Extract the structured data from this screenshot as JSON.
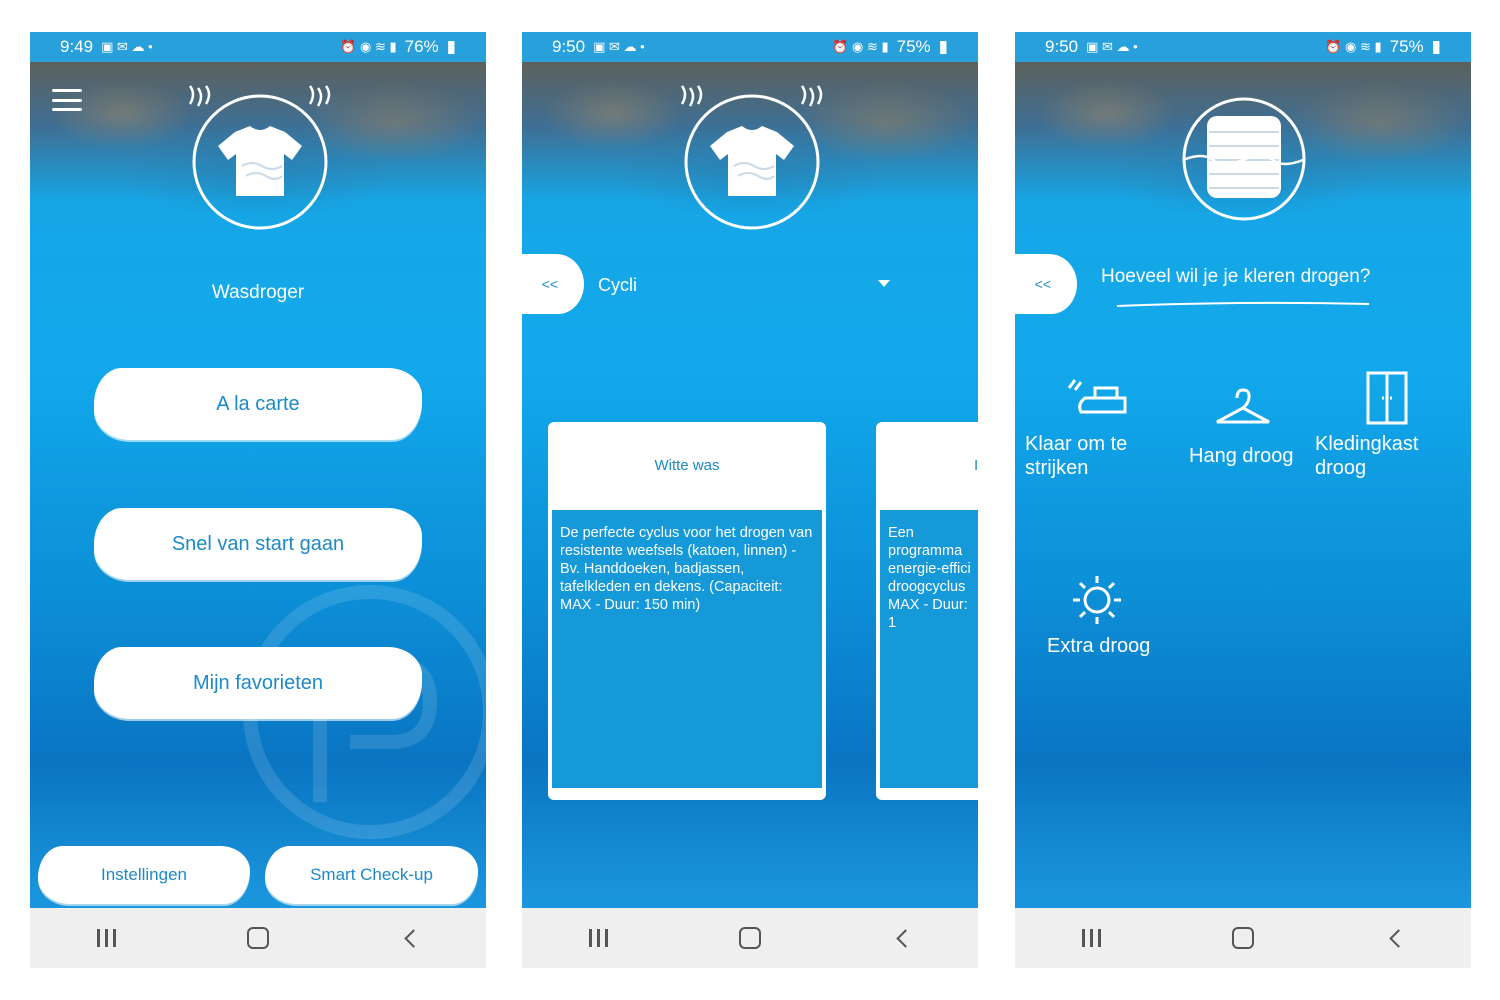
{
  "screens": [
    {
      "status": {
        "time": "9:49",
        "battery": "76%"
      },
      "title": "Wasdroger",
      "buttons": [
        "A la carte",
        "Snel van start gaan",
        "Mijn favorieten"
      ],
      "footer": [
        "Instellingen",
        "Smart Check-up"
      ]
    },
    {
      "status": {
        "time": "9:50",
        "battery": "75%"
      },
      "back_label": "<<",
      "dropdown_value": "Cycli",
      "cards": [
        {
          "title": "Witte was",
          "description": "De perfecte cyclus voor het drogen van resistente weefsels (katoen, linnen) - Bv. Handdoeken, badjassen, tafelkleden en dekens. (Capaciteit: MAX - Duur: 150 min)"
        },
        {
          "title": "I",
          "description": "Een programma energie-effici droogcyclus MAX - Duur: 1"
        }
      ]
    },
    {
      "status": {
        "time": "9:50",
        "battery": "75%"
      },
      "back_label": "<<",
      "question": "Hoeveel wil je je kleren drogen?",
      "options": [
        {
          "line1": "Klaar om te",
          "line2": "strijken",
          "icon": "iron-icon"
        },
        {
          "line1": "Hang droog",
          "icon": "hanger-icon"
        },
        {
          "line1": "Kledingkast",
          "line2": "droog",
          "icon": "wardrobe-icon"
        },
        {
          "line1": "Extra droog",
          "icon": "sun-icon"
        }
      ]
    }
  ],
  "colors": {
    "accent": "#1d8ac8",
    "status_bar": "#27a0dc",
    "nav_bar": "#efefef"
  }
}
